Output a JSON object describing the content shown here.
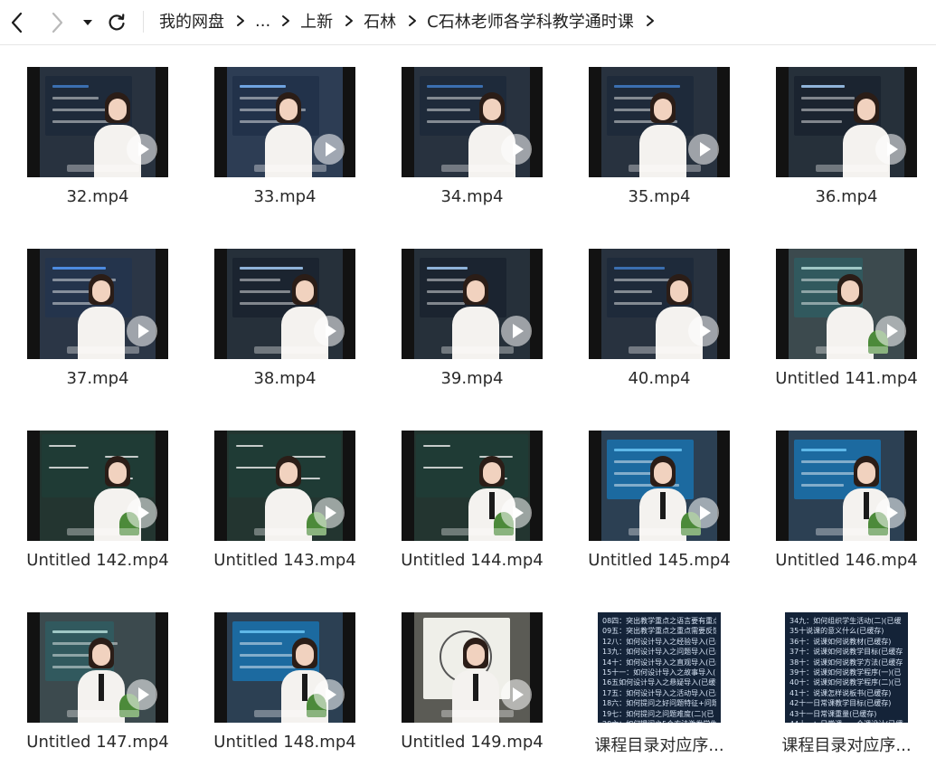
{
  "breadcrumb": {
    "items": [
      "我的网盘",
      "...",
      "上新",
      "石林",
      "C石林老师各学科教学通时课"
    ]
  },
  "files": [
    {
      "name": "32.mp4",
      "type": "video",
      "theme": "slide-dark"
    },
    {
      "name": "33.mp4",
      "type": "video",
      "theme": "slide-blue"
    },
    {
      "name": "34.mp4",
      "type": "video",
      "theme": "slide-dark"
    },
    {
      "name": "35.mp4",
      "type": "video",
      "theme": "slide-dark"
    },
    {
      "name": "36.mp4",
      "type": "video",
      "theme": "slide-text"
    },
    {
      "name": "37.mp4",
      "type": "video",
      "theme": "slide-list"
    },
    {
      "name": "38.mp4",
      "type": "video",
      "theme": "slide-text"
    },
    {
      "name": "39.mp4",
      "type": "video",
      "theme": "slide-text"
    },
    {
      "name": "40.mp4",
      "type": "video",
      "theme": "slide-dark"
    },
    {
      "name": "Untitled 141.mp4",
      "type": "video",
      "theme": "room"
    },
    {
      "name": "Untitled 142.mp4",
      "type": "video",
      "theme": "chalkboard"
    },
    {
      "name": "Untitled 143.mp4",
      "type": "video",
      "theme": "chalkboard"
    },
    {
      "name": "Untitled 144.mp4",
      "type": "video",
      "theme": "chalkboard"
    },
    {
      "name": "Untitled 145.mp4",
      "type": "video",
      "theme": "screen-blue"
    },
    {
      "name": "Untitled 146.mp4",
      "type": "video",
      "theme": "screen-blue"
    },
    {
      "name": "Untitled 147.mp4",
      "type": "video",
      "theme": "room"
    },
    {
      "name": "Untitled 148.mp4",
      "type": "video",
      "theme": "screen-blue"
    },
    {
      "name": "Untitled 149.mp4",
      "type": "video",
      "theme": "whiteboard"
    },
    {
      "name": "课程目录对应序...",
      "type": "doc",
      "lines": [
        "08四：突出教学重点之语言要有重点(",
        "09五：突出教学重点之重点需要反馈(",
        "12八：如何设计导入之经验导入(已缓",
        "13九：如何设计导入之问题导入(已缓",
        "14十：如何设计导入之直观导入(已缓",
        "15十一：如何设计导入之故事导入(已缓",
        "16五如何设计导入之悬疑导入(已缓存",
        "17五：如何设计导入之活动导入(已缓",
        "18六：如何提问之好问题特征+问题",
        "19七：如何提问之问题难度(二)(已",
        "20六：如何提问之5个方法激发学生自"
      ]
    },
    {
      "name": "课程目录对应序...",
      "type": "doc",
      "lines": [
        "34九：如何组织学生活动(二)(已缓",
        "35十说课的意义什么(已缓存)",
        "36十：说课如何说教材(已缓存)",
        "37十：说课如何说教学目标(已缓存)",
        "38十：说课如何说教学方法(已缓存)",
        "39十：说课如何说教学程序(一)(已",
        "40十：说课如何说教学程序(二)(已",
        "41十：说课怎样说板书(已缓存)",
        "42十一日常课教学目标(已缓存)",
        "43十一日常课重量(已缓存)",
        "44十一：日常课——全课设计(已缓存"
      ]
    }
  ]
}
